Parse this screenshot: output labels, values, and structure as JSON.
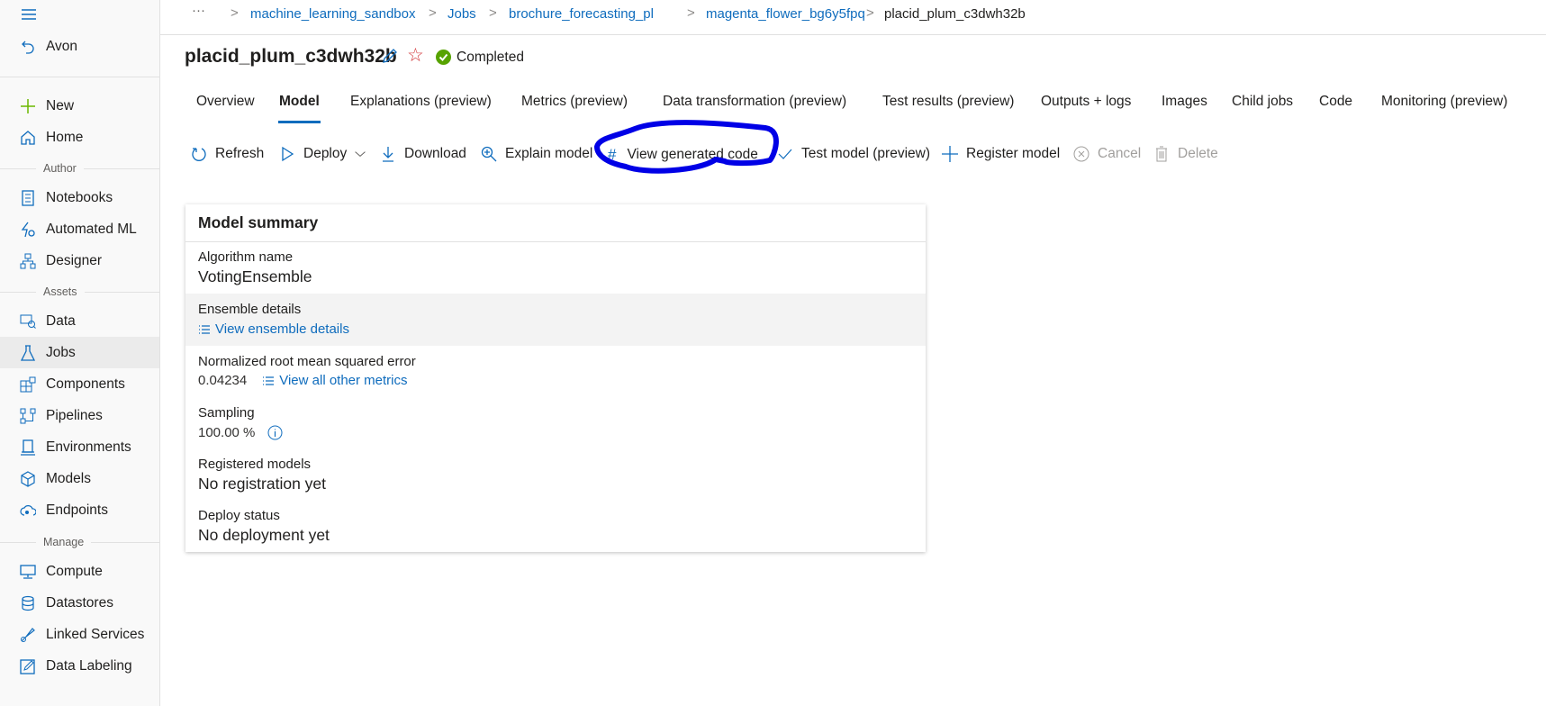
{
  "sidebar": {
    "back_label": "Avon",
    "new_label": "New",
    "home_label": "Home",
    "sections": {
      "author": "Author",
      "assets": "Assets",
      "manage": "Manage"
    },
    "author_items": [
      {
        "label": "Notebooks",
        "icon": "notebook-icon"
      },
      {
        "label": "Automated ML",
        "icon": "automl-icon"
      },
      {
        "label": "Designer",
        "icon": "designer-icon"
      }
    ],
    "asset_items": [
      {
        "label": "Data",
        "icon": "data-icon"
      },
      {
        "label": "Jobs",
        "icon": "flask-icon",
        "active": true
      },
      {
        "label": "Components",
        "icon": "components-icon"
      },
      {
        "label": "Pipelines",
        "icon": "pipelines-icon"
      },
      {
        "label": "Environments",
        "icon": "environment-icon"
      },
      {
        "label": "Models",
        "icon": "cube-icon"
      },
      {
        "label": "Endpoints",
        "icon": "endpoint-icon"
      }
    ],
    "manage_items": [
      {
        "label": "Compute",
        "icon": "monitor-icon"
      },
      {
        "label": "Datastores",
        "icon": "database-icon"
      },
      {
        "label": "Linked Services",
        "icon": "link-icon"
      },
      {
        "label": "Data Labeling",
        "icon": "edit-box-icon"
      }
    ]
  },
  "breadcrumb": {
    "more": "···",
    "items": [
      "machine_learning_sandbox",
      "Jobs",
      "brochure_forecasting_pl",
      "magenta_flower_bg6y5fpq"
    ],
    "current": "placid_plum_c3dwh32b"
  },
  "header": {
    "title": "placid_plum_c3dwh32b",
    "status": "Completed",
    "status_color": "#57a300"
  },
  "tabs": [
    "Overview",
    "Model",
    "Explanations (preview)",
    "Metrics (preview)",
    "Data transformation (preview)",
    "Test results (preview)",
    "Outputs + logs",
    "Images",
    "Child jobs",
    "Code",
    "Monitoring (preview)"
  ],
  "active_tab": "Model",
  "toolbar": {
    "refresh": "Refresh",
    "deploy": "Deploy",
    "download": "Download",
    "explain": "Explain model",
    "view_code": "View generated code",
    "test": "Test model (preview)",
    "register": "Register model",
    "cancel": "Cancel",
    "delete": "Delete"
  },
  "annotation_color": "#0000e6",
  "accent": "#0f6cbd",
  "summary": {
    "title": "Model summary",
    "algorithm_label": "Algorithm name",
    "algorithm_value": "VotingEnsemble",
    "ensemble_label": "Ensemble details",
    "ensemble_link": "View ensemble details",
    "nrmse_label": "Normalized root mean squared error",
    "nrmse_value": "0.04234",
    "metrics_link": "View all other metrics",
    "sampling_label": "Sampling",
    "sampling_value": "100.00 %",
    "registered_label": "Registered models",
    "registered_value": "No registration yet",
    "deploy_label": "Deploy status",
    "deploy_value": "No deployment yet"
  }
}
